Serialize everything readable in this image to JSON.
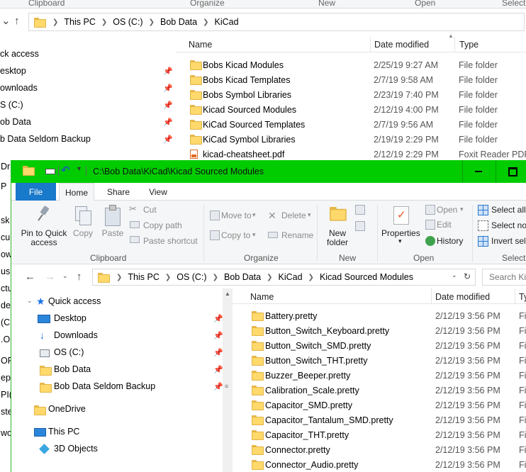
{
  "back_window": {
    "ribbon_groups": [
      "Clipboard",
      "Organize",
      "New",
      "Open",
      "Select"
    ],
    "breadcrumb": [
      "This PC",
      "OS (C:)",
      "Bob Data",
      "KiCad"
    ],
    "nav_items": [
      {
        "label": "ck access",
        "pinned": false
      },
      {
        "label": "esktop",
        "pinned": true
      },
      {
        "label": "ownloads",
        "pinned": true
      },
      {
        "label": "S (C:)",
        "pinned": true
      },
      {
        "label": "ob Data",
        "pinned": true
      },
      {
        "label": "b Data Seldom Backup",
        "pinned": true
      }
    ],
    "columns": [
      "Name",
      "Date modified",
      "Type"
    ],
    "rows": [
      {
        "icon": "folder-icon",
        "name": "Bobs Kicad Modules",
        "date": "2/25/19 9:27 AM",
        "type": "File folder"
      },
      {
        "icon": "folder-icon",
        "name": "Bobs Kicad Templates",
        "date": "2/7/19 9:58 AM",
        "type": "File folder"
      },
      {
        "icon": "folder-icon",
        "name": "Bobs Symbol Libraries",
        "date": "2/23/19 7:40 PM",
        "type": "File folder"
      },
      {
        "icon": "folder-icon",
        "name": "Kicad Sourced Modules",
        "date": "2/12/19 4:00 PM",
        "type": "File folder"
      },
      {
        "icon": "folder-icon",
        "name": "KiCad Sourced Templates",
        "date": "2/7/19 9:56 AM",
        "type": "File folder"
      },
      {
        "icon": "folder-icon",
        "name": "KiCad Symbol Libraries",
        "date": "2/19/19 2:29 PM",
        "type": "File folder"
      },
      {
        "icon": "pdf-icon",
        "name": "kicad-cheatsheet.pdf",
        "date": "2/12/19 2:29 PM",
        "type": "Foxit Reader PDF ..."
      }
    ],
    "left_edge_fragments": [
      "Dr",
      "P",
      "sk",
      "cu",
      "ow",
      "usi",
      "ctu",
      "de",
      "(C",
      ".O",
      "OP",
      "ep",
      "PI(",
      "ste",
      "wo"
    ]
  },
  "front_window": {
    "title": "C:\\Bob Data\\KiCad\\Kicad Sourced Modules",
    "tabs": [
      "File",
      "Home",
      "Share",
      "View"
    ],
    "active_tab": "Home",
    "ribbon": {
      "pin_to_quick_access": "Pin to Quick access",
      "copy": "Copy",
      "paste": "Paste",
      "cut": "Cut",
      "copy_path": "Copy path",
      "paste_shortcut": "Paste shortcut",
      "clipboard_group": "Clipboard",
      "move_to": "Move to",
      "copy_to": "Copy to",
      "delete": "Delete",
      "rename": "Rename",
      "organize_group": "Organize",
      "new_folder": "New folder",
      "new_group": "New",
      "properties": "Properties",
      "open": "Open",
      "edit": "Edit",
      "history": "History",
      "open_group": "Open",
      "select_all": "Select all",
      "select_none": "Select no",
      "invert_selection": "Invert sele",
      "select_group": "Select"
    },
    "breadcrumb": [
      "This PC",
      "OS (C:)",
      "Bob Data",
      "KiCad",
      "Kicad Sourced Modules"
    ],
    "search_placeholder": "Search Kic",
    "nav": {
      "quick_access": "Quick access",
      "items": [
        {
          "label": "Desktop",
          "icon": "desktop-icon",
          "pinned": true
        },
        {
          "label": "Downloads",
          "icon": "downloads-icon",
          "pinned": true
        },
        {
          "label": "OS (C:)",
          "icon": "drive-icon",
          "pinned": true
        },
        {
          "label": "Bob Data",
          "icon": "folder-icon",
          "pinned": true
        },
        {
          "label": "Bob Data Seldom Backup",
          "icon": "folder-icon",
          "pinned": true
        }
      ],
      "onedrive": "OneDrive",
      "this_pc": "This PC",
      "objects_3d": "3D Objects"
    },
    "columns": [
      "Name",
      "Date modified",
      "Ty"
    ],
    "rows": [
      {
        "name": "Battery.pretty",
        "date": "2/12/19 3:56 PM",
        "type": "Fi"
      },
      {
        "name": "Button_Switch_Keyboard.pretty",
        "date": "2/12/19 3:56 PM",
        "type": "Fi"
      },
      {
        "name": "Button_Switch_SMD.pretty",
        "date": "2/12/19 3:56 PM",
        "type": "Fi"
      },
      {
        "name": "Button_Switch_THT.pretty",
        "date": "2/12/19 3:56 PM",
        "type": "Fi"
      },
      {
        "name": "Buzzer_Beeper.pretty",
        "date": "2/12/19 3:56 PM",
        "type": "Fi"
      },
      {
        "name": "Calibration_Scale.pretty",
        "date": "2/12/19 3:56 PM",
        "type": "Fi"
      },
      {
        "name": "Capacitor_SMD.pretty",
        "date": "2/12/19 3:56 PM",
        "type": "Fi"
      },
      {
        "name": "Capacitor_Tantalum_SMD.pretty",
        "date": "2/12/19 3:56 PM",
        "type": "Fi"
      },
      {
        "name": "Capacitor_THT.pretty",
        "date": "2/12/19 3:56 PM",
        "type": "Fi"
      },
      {
        "name": "Connector.pretty",
        "date": "2/12/19 3:56 PM",
        "type": "Fi"
      },
      {
        "name": "Connector_Audio.pretty",
        "date": "2/12/19 3:56 PM",
        "type": "Fi"
      }
    ]
  },
  "colors": {
    "active_title_bar": "#00cc00",
    "file_tab": "#1979ca",
    "folder": "#ffd96b"
  }
}
